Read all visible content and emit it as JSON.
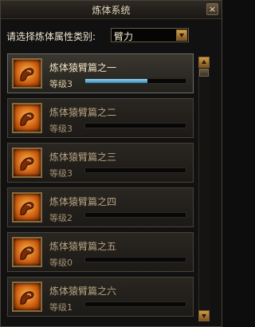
{
  "window": {
    "title": "炼体系统",
    "close_glyph": "×"
  },
  "filter": {
    "label": "请选择炼体属性类别:",
    "selected": "臂力"
  },
  "items": [
    {
      "name": "炼体猿臂篇之一",
      "level": "等级3",
      "progress": 0.62,
      "selected": true
    },
    {
      "name": "炼体猿臂篇之二",
      "level": "等级3",
      "progress": 0
    },
    {
      "name": "炼体猿臂篇之三",
      "level": "等级3",
      "progress": 0
    },
    {
      "name": "炼体猿臂篇之四",
      "level": "等级2",
      "progress": 0
    },
    {
      "name": "炼体猿臂篇之五",
      "level": "等级0",
      "progress": 0
    },
    {
      "name": "炼体猿臂篇之六",
      "level": "等级1",
      "progress": 0
    }
  ],
  "colors": {
    "accent": "#d6a24a",
    "progress": "#5fb1de"
  }
}
